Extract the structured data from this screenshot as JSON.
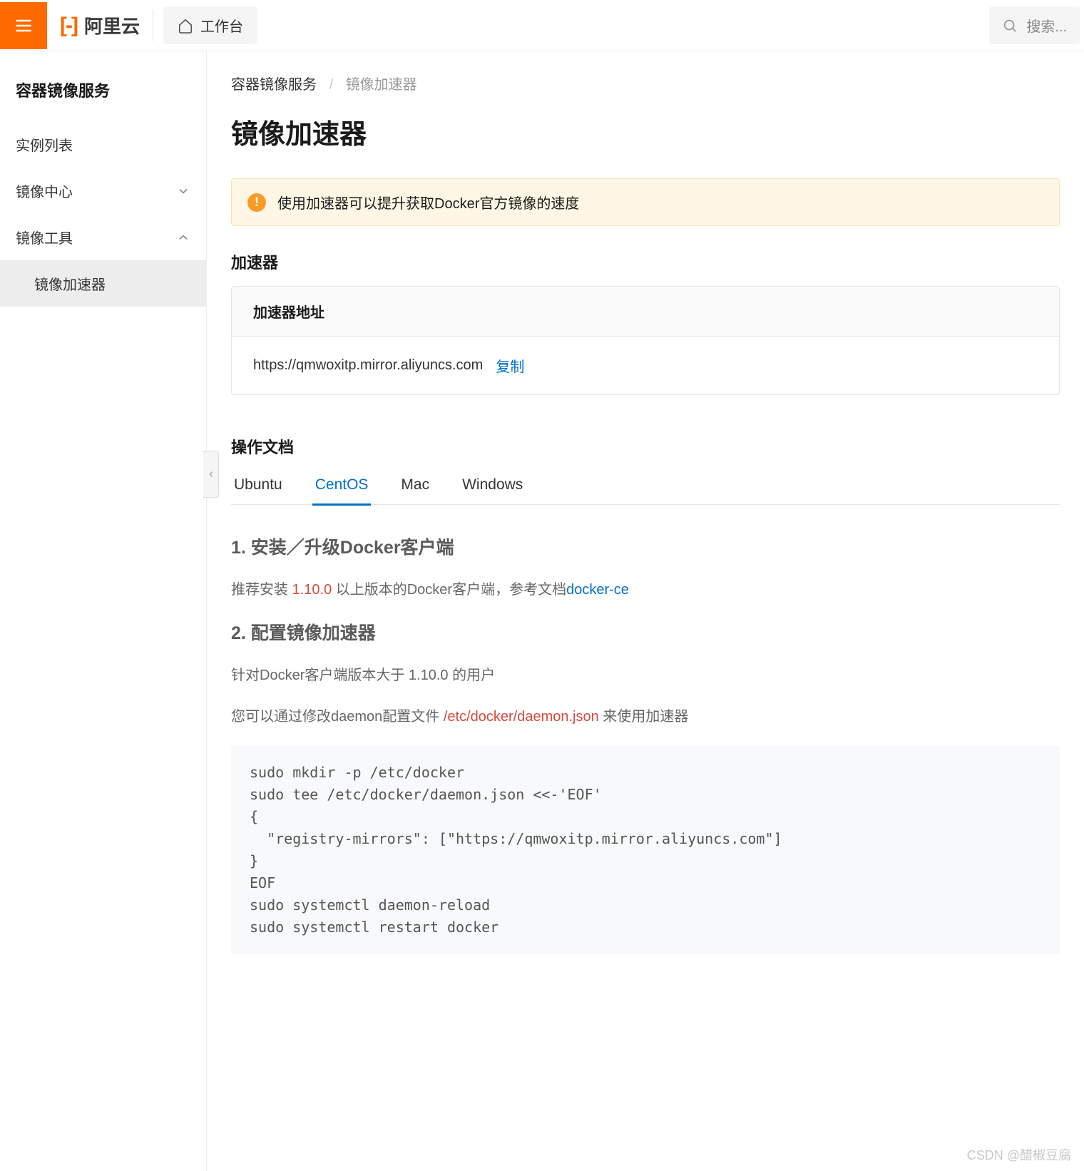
{
  "header": {
    "brand": "阿里云",
    "workspace_label": "工作台",
    "search_placeholder": "搜索..."
  },
  "sidebar": {
    "title": "容器镜像服务",
    "items": [
      {
        "label": "实例列表",
        "expandable": false
      },
      {
        "label": "镜像中心",
        "expandable": true,
        "expanded": false
      },
      {
        "label": "镜像工具",
        "expandable": true,
        "expanded": true
      },
      {
        "label": "镜像加速器",
        "expandable": false,
        "active": true,
        "child": true
      }
    ]
  },
  "breadcrumb": {
    "root": "容器镜像服务",
    "current": "镜像加速器"
  },
  "page": {
    "title": "镜像加速器",
    "alert": "使用加速器可以提升获取Docker官方镜像的速度"
  },
  "accelerator": {
    "section_title": "加速器",
    "addr_label": "加速器地址",
    "addr_url": "https://qmwoxitp.mirror.aliyuncs.com",
    "copy_label": "复制"
  },
  "docs": {
    "section_title": "操作文档",
    "tabs": [
      "Ubuntu",
      "CentOS",
      "Mac",
      "Windows"
    ],
    "active_tab": "CentOS",
    "step1_title": "1. 安装／升级Docker客户端",
    "step1_text_a": "推荐安装 ",
    "step1_version": "1.10.0",
    "step1_text_b": " 以上版本的Docker客户端，参考文档",
    "step1_link": "docker-ce",
    "step2_title": "2. 配置镜像加速器",
    "step2_p1": "针对Docker客户端版本大于 1.10.0 的用户",
    "step2_p2a": "您可以通过修改daemon配置文件 ",
    "step2_p2_path": "/etc/docker/daemon.json",
    "step2_p2b": " 来使用加速器",
    "code": "sudo mkdir -p /etc/docker\nsudo tee /etc/docker/daemon.json <<-'EOF'\n{\n  \"registry-mirrors\": [\"https://qmwoxitp.mirror.aliyuncs.com\"]\n}\nEOF\nsudo systemctl daemon-reload\nsudo systemctl restart docker"
  },
  "watermark": "CSDN @醋椒豆腐"
}
